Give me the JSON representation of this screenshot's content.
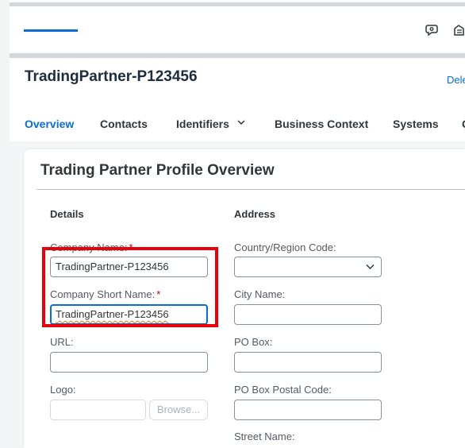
{
  "header": {
    "object_title": "TradingPartner-P123456",
    "delete_label": "Delete"
  },
  "tabs": [
    {
      "label": "Overview",
      "active": true
    },
    {
      "label": "Contacts"
    },
    {
      "label": "Identifiers",
      "has_dropdown": true
    },
    {
      "label": "Business Context"
    },
    {
      "label": "Systems"
    },
    {
      "label": "C"
    }
  ],
  "card": {
    "title": "Trading Partner Profile Overview"
  },
  "details": {
    "heading": "Details",
    "company_name": {
      "label": "Company Name:",
      "required": "*",
      "value": "TradingPartner-P123456"
    },
    "company_short_name": {
      "label": "Company Short Name:",
      "required": "*",
      "value": "TradingPartner-P123456"
    },
    "url": {
      "label": "URL:",
      "value": ""
    },
    "logo": {
      "label": "Logo:",
      "value": "",
      "browse_label": "Browse..."
    }
  },
  "address": {
    "heading": "Address",
    "country_region_code": {
      "label": "Country/Region Code:",
      "value": ""
    },
    "city_name": {
      "label": "City Name:",
      "value": ""
    },
    "po_box": {
      "label": "PO Box:",
      "value": ""
    },
    "po_box_postal_code": {
      "label": "PO Box Postal Code:",
      "value": ""
    },
    "street_name": {
      "label": "Street Name:"
    }
  },
  "icons": {
    "shell_icon_1": "feedback-icon",
    "shell_icon_2": "notification-icon"
  },
  "colors": {
    "accent": "#0a6ed1",
    "required": "#bb0000",
    "highlight_box": "#e8000b"
  }
}
